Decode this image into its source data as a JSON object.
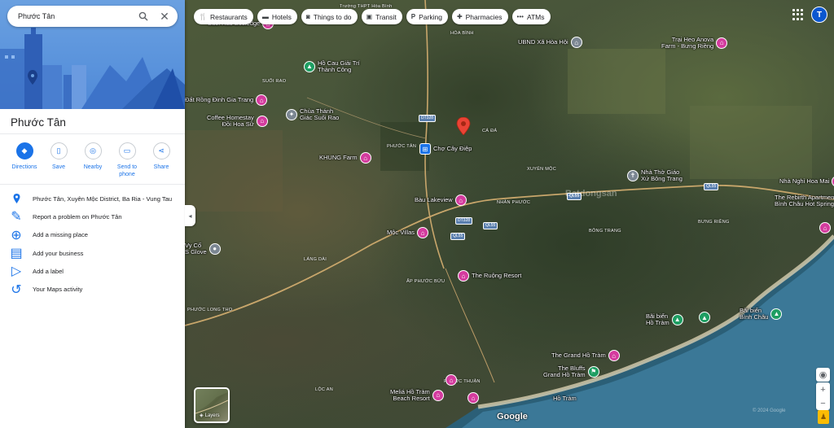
{
  "search": {
    "query": "Phước Tân"
  },
  "panel": {
    "title": "Phước Tân",
    "actions": [
      {
        "label": "Directions"
      },
      {
        "label": "Save"
      },
      {
        "label": "Nearby"
      },
      {
        "label": "Send to\nphone"
      },
      {
        "label": "Share"
      }
    ],
    "info": [
      {
        "text": "Phước Tân, Xuyên Mộc District, Ba Ria - Vung Tau"
      },
      {
        "text": "Report a problem on Phước Tân"
      },
      {
        "text": "Add a missing place"
      },
      {
        "text": "Add your business"
      },
      {
        "text": "Add a label"
      },
      {
        "text": "Your Maps activity"
      }
    ]
  },
  "chips": [
    {
      "label": "Restaurants",
      "icon": "restaurant-icon"
    },
    {
      "label": "Hotels",
      "icon": "hotel-icon"
    },
    {
      "label": "Things to do",
      "icon": "camera-icon"
    },
    {
      "label": "Transit",
      "icon": "transit-icon"
    },
    {
      "label": "Parking",
      "icon": "parking-icon"
    },
    {
      "label": "Pharmacies",
      "icon": "pharmacy-icon"
    },
    {
      "label": "ATMs",
      "icon": "more-icon"
    }
  ],
  "account": {
    "initial": "T"
  },
  "map": {
    "pois": [
      {
        "label": "Suối Rao Ecolodge",
        "kind": "pink"
      },
      {
        "label": "Hồ Cau Giải Trí\nThành Công",
        "kind": "green"
      },
      {
        "label": "Đất Rồng Đinh Gia Trang",
        "kind": "pink"
      },
      {
        "label": "Chùa Thánh\nGiác Suối Rao",
        "kind": "gray"
      },
      {
        "label": "Coffee Homestay\nĐồi Hoa Sữ",
        "kind": "pink"
      },
      {
        "label": "KHUNG Farm",
        "kind": "pink"
      },
      {
        "label": "Chợ Cây Điệp",
        "kind": "blue"
      },
      {
        "label": "UBND Xã Hòa Hội",
        "kind": "gray"
      },
      {
        "label": "Trại Heo Anova\nFarm - Bưng Riềng",
        "kind": "pink"
      },
      {
        "label": "Nhà Thờ Giáo\nXứ Bông Trang",
        "kind": "gray"
      },
      {
        "label": "Nhà Nghỉ Hoa Mai",
        "kind": "pink"
      },
      {
        "label": "The Rebirth Apartment\nBình Châu Hot Spring",
        "kind": "pink"
      },
      {
        "label": "Bàu Lakeview",
        "kind": "pink"
      },
      {
        "label": "Mộc Villas",
        "kind": "pink"
      },
      {
        "label": "Vy Cố\nS Glove",
        "kind": "gray"
      },
      {
        "label": "The Ruộng Resort",
        "kind": "pink"
      },
      {
        "label": "Bãi biển\nHồ Tràm",
        "kind": "green"
      },
      {
        "label": "Bãi biển\nBình Châu",
        "kind": "green"
      },
      {
        "label": "The Grand Hồ Tràm",
        "kind": "pink"
      },
      {
        "label": "The Bluffs\nGrand Hồ Tràm",
        "kind": "green"
      },
      {
        "label": "Meliá Hồ Tràm\nBeach Resort",
        "kind": "pink"
      },
      {
        "label": "Hồ Tràm",
        "kind": "pink"
      }
    ],
    "area_labels": [
      "Trường THPT Hòa Bình",
      "HÒA BÌNH",
      "SUỐI RAO",
      "PHƯỚC TÂN",
      "CÁ ĐÁ",
      "XUYÊN MỘC",
      "NHÂN PHƯỚC",
      "BÔNG TRANG",
      "BƯNG RIỀNG",
      "LÁNG DÀI",
      "ẤP PHƯỚC BỬU",
      "PHƯỚC LONG THỌ",
      "PHƯỚC THUẬN",
      "LỘC AN"
    ],
    "road_shields": [
      "DT328",
      "QL55",
      "DT328",
      "QL55",
      "QL55",
      "QL55"
    ],
    "watermark": "Batdongsan",
    "layers_label": "Layers",
    "google": "Google",
    "copyright": "© 2024 Google"
  }
}
